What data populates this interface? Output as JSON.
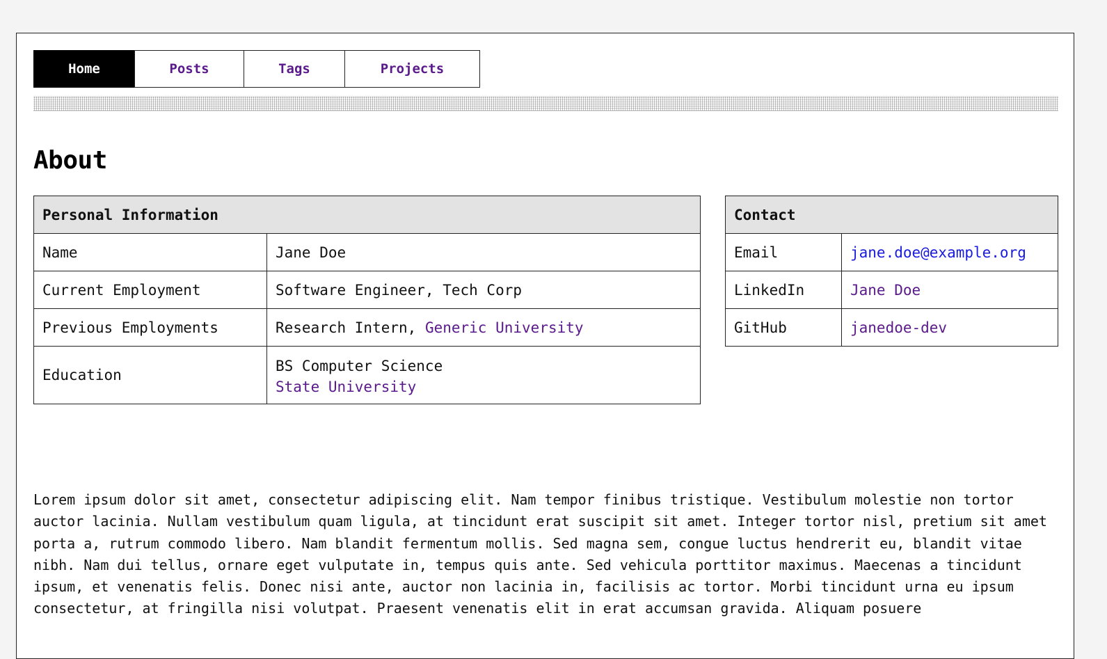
{
  "nav": {
    "items": [
      {
        "label": "Home",
        "active": true
      },
      {
        "label": "Posts",
        "active": false
      },
      {
        "label": "Tags",
        "active": false
      },
      {
        "label": "Projects",
        "active": false
      }
    ]
  },
  "page_title": "About",
  "personal": {
    "header": "Personal Information",
    "rows": {
      "name": {
        "key": "Name",
        "value": "Jane Doe"
      },
      "current": {
        "key": "Current Employment",
        "value": "Software Engineer, Tech Corp"
      },
      "previous": {
        "key": "Previous Employments",
        "value_prefix": "Research Intern,",
        "link": "Generic University"
      },
      "education": {
        "key": "Education",
        "degree": "BS Computer Science",
        "link": "State University"
      }
    }
  },
  "contact": {
    "header": "Contact",
    "rows": {
      "email": {
        "key": "Email",
        "link": "jane.doe@example.org"
      },
      "linkedin": {
        "key": "LinkedIn",
        "link": "Jane Doe"
      },
      "github": {
        "key": "GitHub",
        "link": "janedoe-dev"
      }
    }
  },
  "body_text": "Lorem ipsum dolor sit amet, consectetur adipiscing elit. Nam tempor finibus tristique. Vestibulum molestie non tortor auctor lacinia. Nullam vestibulum quam ligula, at tincidunt erat suscipit sit amet. Integer tortor nisl, pretium sit amet porta a, rutrum commodo libero. Nam blandit fermentum mollis. Sed magna sem, congue luctus hendrerit eu, blandit vitae nibh. Nam dui tellus, ornare eget vulputate in, tempus quis ante. Sed vehicula porttitor maximus. Maecenas a tincidunt ipsum, et venenatis felis. Donec nisi ante, auctor non lacinia in, facilisis ac tortor. Morbi tincidunt urna eu ipsum consectetur, at fringilla nisi volutpat. Praesent venenatis elit in erat accumsan gravida. Aliquam posuere",
  "colors": {
    "link_visited": "#5a1a8c",
    "link_unvisited": "#1a1ae0",
    "header_bg": "#e3e3e3",
    "nav_active_bg": "#000000"
  }
}
